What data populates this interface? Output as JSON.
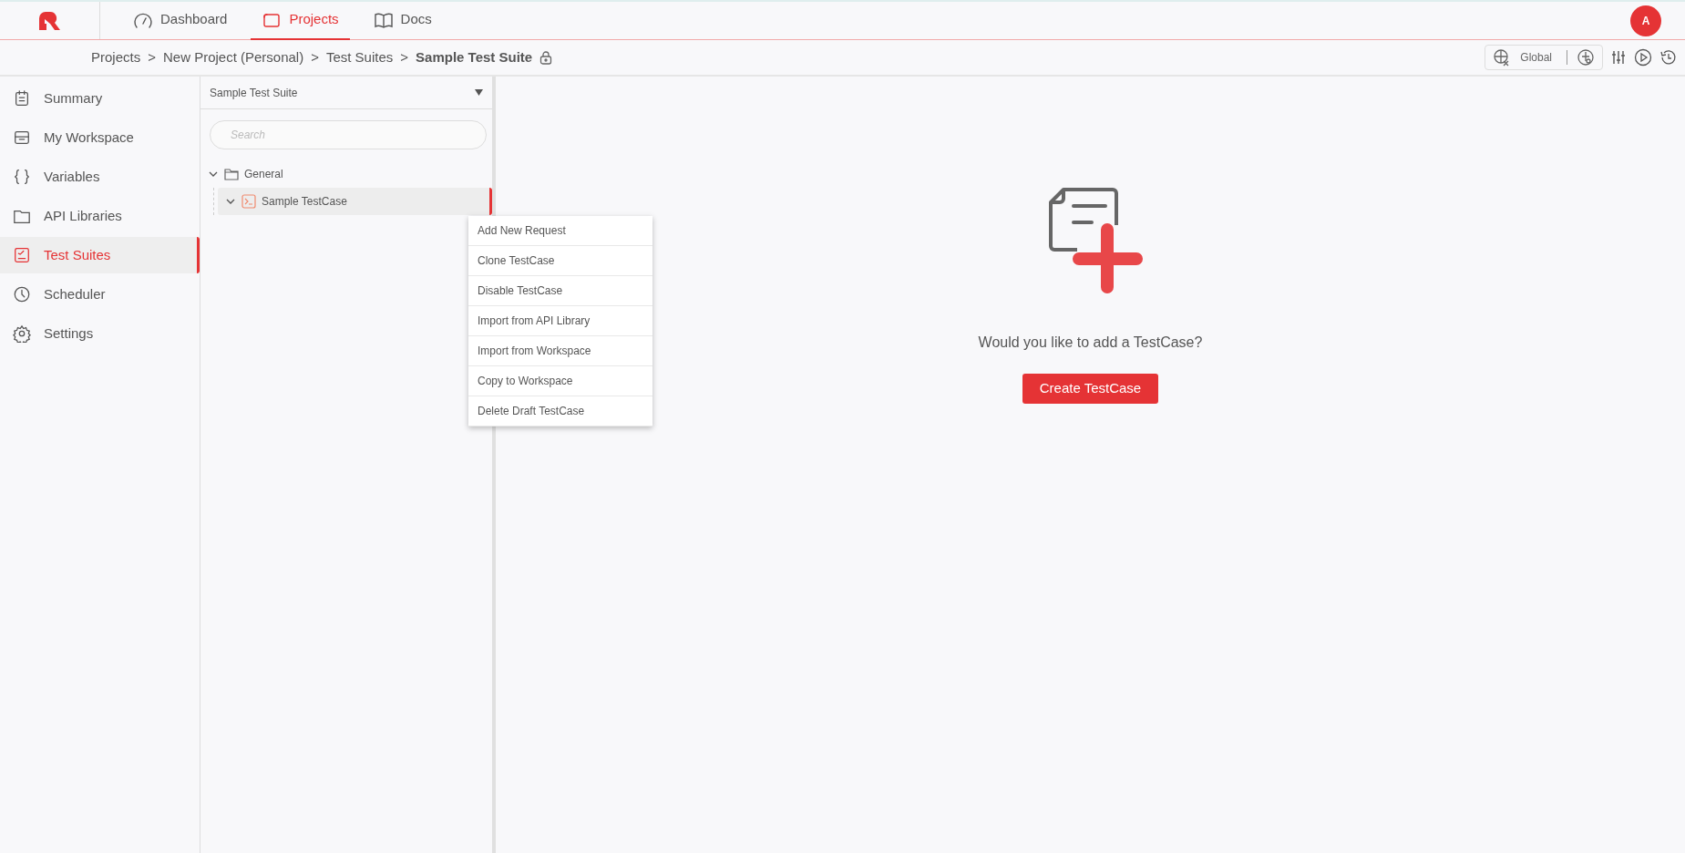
{
  "top_nav": {
    "tabs": [
      {
        "label": "Dashboard",
        "selected": false
      },
      {
        "label": "Projects",
        "selected": true
      },
      {
        "label": "Docs",
        "selected": false
      }
    ],
    "avatar": "A"
  },
  "breadcrumb": {
    "items": [
      {
        "label": "Projects",
        "current": false
      },
      {
        "label": "New Project (Personal)",
        "current": false
      },
      {
        "label": "Test Suites",
        "current": false
      },
      {
        "label": "Sample Test Suite",
        "current": true
      }
    ],
    "separator": ">",
    "locked": true
  },
  "toolbar": {
    "environment": "Global"
  },
  "sidebar": {
    "items": [
      {
        "label": "Summary",
        "selected": false
      },
      {
        "label": "My Workspace",
        "selected": false
      },
      {
        "label": "Variables",
        "selected": false
      },
      {
        "label": "API Libraries",
        "selected": false
      },
      {
        "label": "Test Suites",
        "selected": true
      },
      {
        "label": "Scheduler",
        "selected": false
      },
      {
        "label": "Settings",
        "selected": false
      }
    ]
  },
  "tree_panel": {
    "suite": "Sample Test Suite",
    "search": {
      "placeholder": "Search"
    },
    "tree": [
      {
        "label": "General",
        "kind": "folder",
        "expanded": true,
        "selected": false,
        "children": [
          {
            "label": "Sample TestCase",
            "kind": "testcase",
            "expanded": true,
            "selected": true
          }
        ]
      }
    ]
  },
  "context_menu": {
    "items": [
      "Add New Request",
      "Clone TestCase",
      "Disable TestCase",
      "Import from API Library",
      "Import from Workspace",
      "Copy to Workspace",
      "Delete Draft TestCase"
    ]
  },
  "empty_state": {
    "message": "Would you like to add a TestCase?",
    "button": "Create TestCase"
  }
}
